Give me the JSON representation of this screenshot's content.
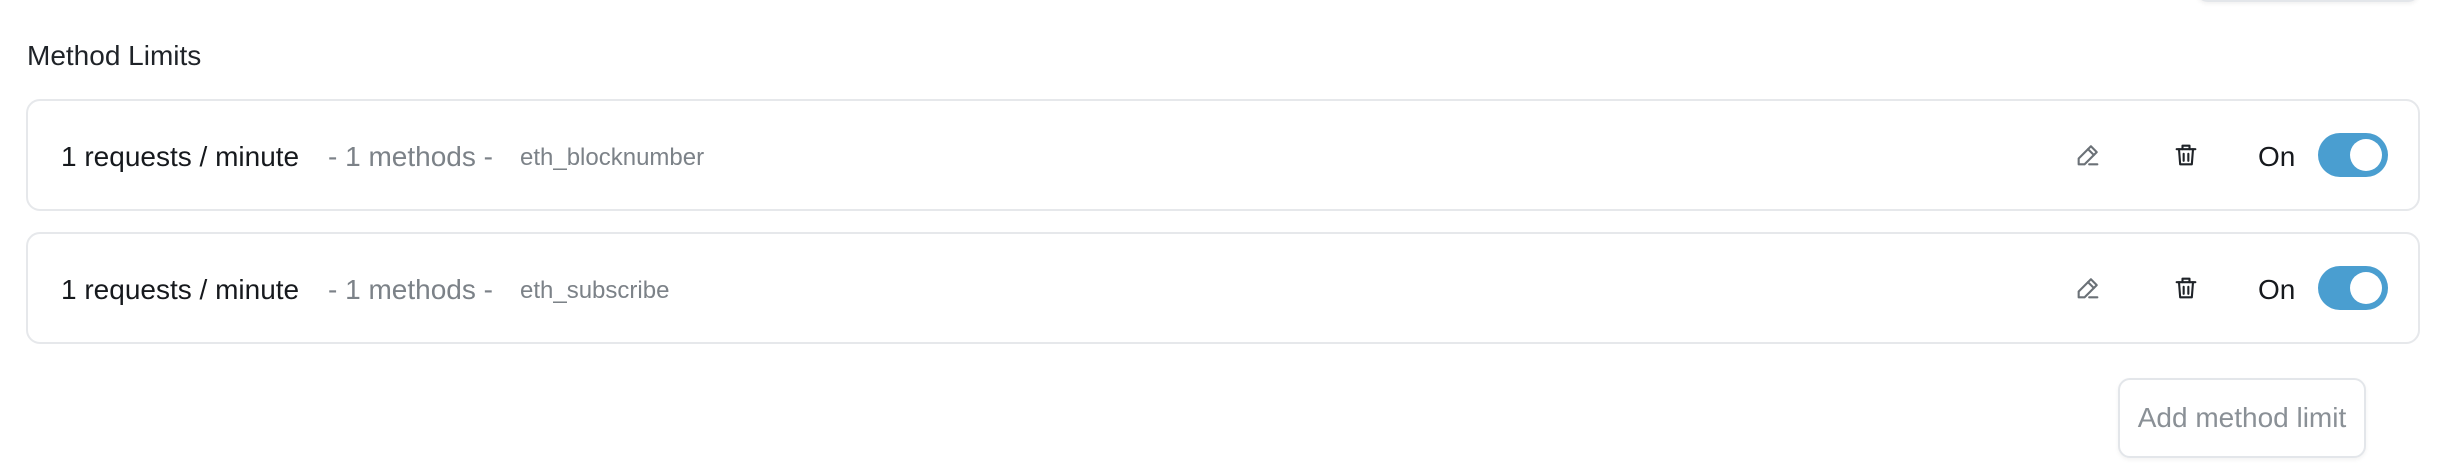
{
  "section": {
    "title": "Method Limits"
  },
  "limits": [
    {
      "rate": "1 requests / minute",
      "methods_count": "- 1 methods -",
      "method": "eth_blocknumber",
      "status_label": "On",
      "enabled": true
    },
    {
      "rate": "1 requests / minute",
      "methods_count": "- 1 methods -",
      "method": "eth_subscribe",
      "status_label": "On",
      "enabled": true
    }
  ],
  "actions": {
    "add_label": "Add method limit"
  },
  "icons": {
    "edit": "pencil-icon",
    "delete": "trash-icon"
  },
  "colors": {
    "toggle_on": "#4a9ed0",
    "muted_text": "#7c8288",
    "border": "#e6e8eb"
  }
}
